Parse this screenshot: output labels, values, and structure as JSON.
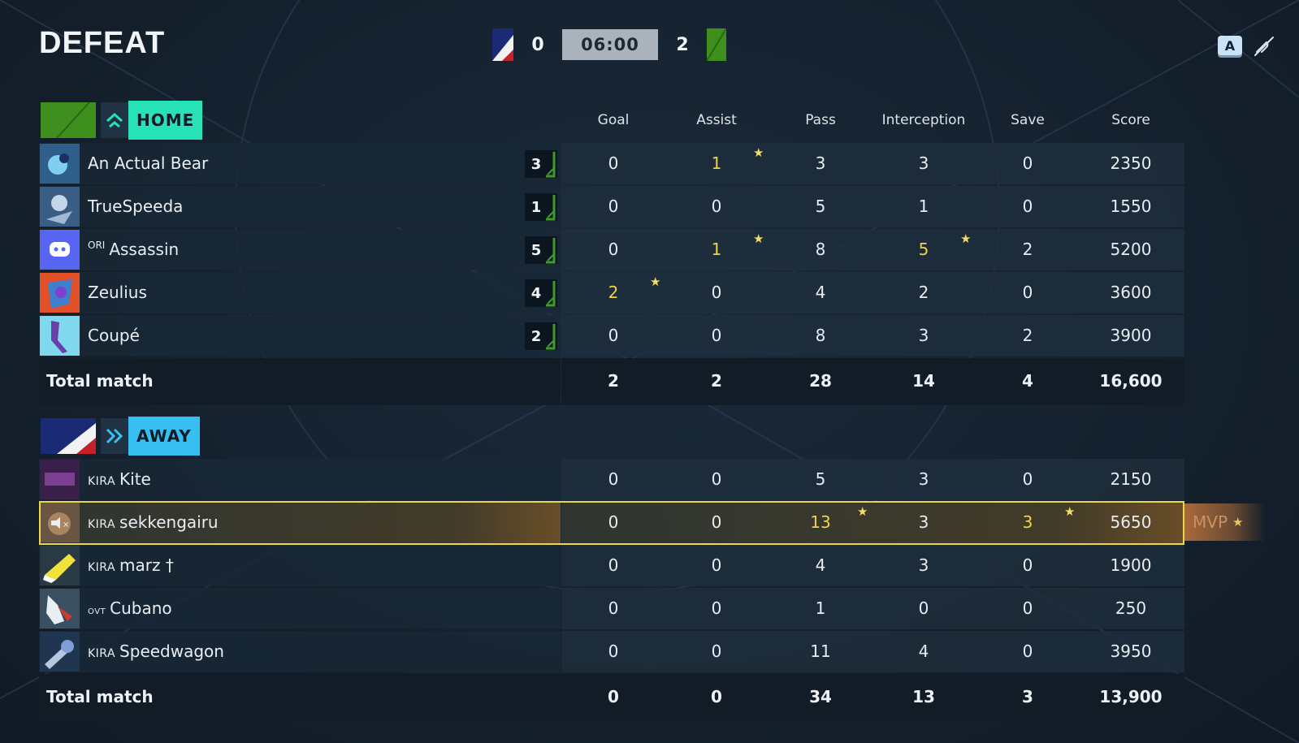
{
  "result": "DEFEAT",
  "scoreboard": {
    "away_score": "0",
    "timer": "06:00",
    "home_score": "2"
  },
  "controls": {
    "key_label": "A",
    "mute_icon": "mic-muted-icon"
  },
  "columns": [
    "Goal",
    "Assist",
    "Pass",
    "Interception",
    "Save",
    "Score"
  ],
  "home": {
    "label": "HOME",
    "icon": "chevron-up-icon",
    "players": [
      {
        "tag": "",
        "name": "An Actual Bear",
        "rating": "3",
        "stats": [
          "0",
          "1",
          "3",
          "3",
          "0",
          "2350"
        ],
        "highlight": [
          false,
          true,
          false,
          false,
          false,
          false
        ],
        "stars": [
          false,
          true,
          false,
          false,
          false,
          false
        ]
      },
      {
        "tag": "",
        "name": "TrueSpeeda",
        "rating": "1",
        "stats": [
          "0",
          "0",
          "5",
          "1",
          "0",
          "1550"
        ],
        "highlight": [
          false,
          false,
          false,
          false,
          false,
          false
        ],
        "stars": [
          false,
          false,
          false,
          false,
          false,
          false
        ]
      },
      {
        "tag": "ORI",
        "name": "Assassin",
        "rating": "5",
        "stats": [
          "0",
          "1",
          "8",
          "5",
          "2",
          "5200"
        ],
        "highlight": [
          false,
          true,
          false,
          true,
          false,
          false
        ],
        "stars": [
          false,
          true,
          false,
          true,
          false,
          false
        ]
      },
      {
        "tag": "",
        "name": "Zeulius",
        "rating": "4",
        "stats": [
          "2",
          "0",
          "4",
          "2",
          "0",
          "3600"
        ],
        "highlight": [
          true,
          false,
          false,
          false,
          false,
          false
        ],
        "stars": [
          true,
          false,
          false,
          false,
          false,
          false
        ]
      },
      {
        "tag": "",
        "name": "Coupé",
        "rating": "2",
        "stats": [
          "0",
          "0",
          "8",
          "3",
          "2",
          "3900"
        ],
        "highlight": [
          false,
          false,
          false,
          false,
          false,
          false
        ],
        "stars": [
          false,
          false,
          false,
          false,
          false,
          false
        ]
      }
    ],
    "total_label": "Total match",
    "totals": [
      "2",
      "2",
      "28",
      "14",
      "4",
      "16,600"
    ]
  },
  "away": {
    "label": "AWAY",
    "icon": "double-chevron-right-icon",
    "players": [
      {
        "tag": "KIRA",
        "name": "Kite",
        "stats": [
          "0",
          "0",
          "5",
          "3",
          "0",
          "2150"
        ],
        "highlight": [
          false,
          false,
          false,
          false,
          false,
          false
        ],
        "stars": [
          false,
          false,
          false,
          false,
          false,
          false
        ]
      },
      {
        "tag": "KIRA",
        "name": "sekkengairu",
        "stats": [
          "0",
          "0",
          "13",
          "3",
          "3",
          "5650"
        ],
        "highlight": [
          false,
          false,
          true,
          false,
          true,
          false
        ],
        "stars": [
          false,
          false,
          true,
          false,
          true,
          false
        ],
        "mvp": true
      },
      {
        "tag": "KIRA",
        "name": "marz †",
        "stats": [
          "0",
          "0",
          "4",
          "3",
          "0",
          "1900"
        ],
        "highlight": [
          false,
          false,
          false,
          false,
          false,
          false
        ],
        "stars": [
          false,
          false,
          false,
          false,
          false,
          false
        ]
      },
      {
        "tag": "ovt",
        "name": "Cubano",
        "stats": [
          "0",
          "0",
          "1",
          "0",
          "0",
          "250"
        ],
        "highlight": [
          false,
          false,
          false,
          false,
          false,
          false
        ],
        "stars": [
          false,
          false,
          false,
          false,
          false,
          false
        ]
      },
      {
        "tag": "KIRA",
        "name": "Speedwagon",
        "stats": [
          "0",
          "0",
          "11",
          "4",
          "0",
          "3950"
        ],
        "highlight": [
          false,
          false,
          false,
          false,
          false,
          false
        ],
        "stars": [
          false,
          false,
          false,
          false,
          false,
          false
        ]
      }
    ],
    "total_label": "Total match",
    "totals": [
      "0",
      "0",
      "34",
      "13",
      "3",
      "13,900"
    ]
  },
  "mvp_label": "MVP",
  "colors": {
    "home": "#27e2b6",
    "away": "#36bff0",
    "highlight": "#f2d24a",
    "mvp_border": "#e8d84a"
  }
}
